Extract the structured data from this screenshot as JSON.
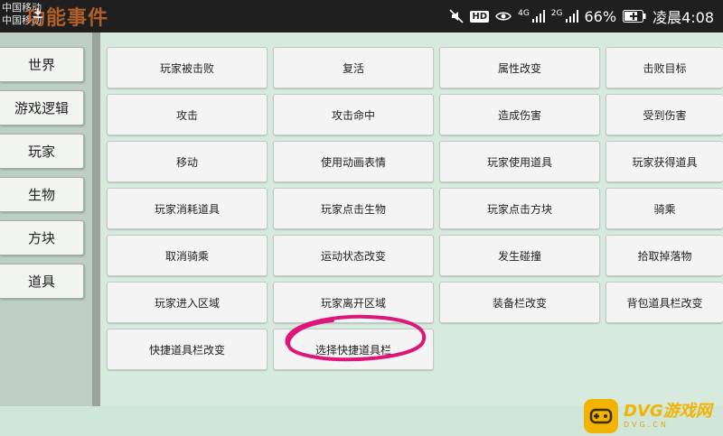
{
  "status_bar": {
    "carrier_1": "中国移动",
    "carrier_2": "中国移动",
    "app_title": "功能事件",
    "hd_label": "HD",
    "net_label_1": "4G",
    "net_label_2": "2G",
    "battery": "66%",
    "time": "凌晨4:08"
  },
  "sidebar": {
    "items": [
      {
        "label": "世界"
      },
      {
        "label": "游戏逻辑"
      },
      {
        "label": "玩家"
      },
      {
        "label": "生物"
      },
      {
        "label": "方块"
      },
      {
        "label": "道具"
      }
    ]
  },
  "events": {
    "items": [
      {
        "label": "玩家被击败"
      },
      {
        "label": "复活"
      },
      {
        "label": "属性改变"
      },
      {
        "label": "击败目标"
      },
      {
        "label": "攻击"
      },
      {
        "label": "攻击命中"
      },
      {
        "label": "造成伤害"
      },
      {
        "label": "受到伤害"
      },
      {
        "label": "移动"
      },
      {
        "label": "使用动画表情"
      },
      {
        "label": "玩家使用道具"
      },
      {
        "label": "玩家获得道具"
      },
      {
        "label": "玩家消耗道具"
      },
      {
        "label": "玩家点击生物"
      },
      {
        "label": "玩家点击方块"
      },
      {
        "label": "骑乘"
      },
      {
        "label": "取消骑乘"
      },
      {
        "label": "运动状态改变"
      },
      {
        "label": "发生碰撞"
      },
      {
        "label": "拾取掉落物"
      },
      {
        "label": "玩家进入区域"
      },
      {
        "label": "玩家离开区域"
      },
      {
        "label": "装备栏改变"
      },
      {
        "label": "背包道具栏改变"
      },
      {
        "label": "快捷道具栏改变"
      },
      {
        "label": "选择快捷道具栏"
      }
    ]
  },
  "annotation": {
    "color": "#e0157a"
  },
  "watermark": {
    "main": "DVG游戏网",
    "sub": "DVG.CN",
    "color": "#f2b400"
  }
}
